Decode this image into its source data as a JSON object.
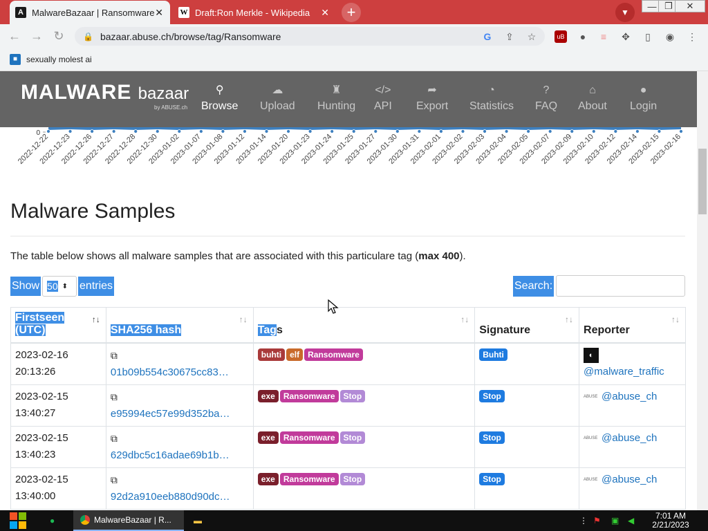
{
  "browser": {
    "tabs": [
      {
        "title": "MalwareBazaar | Ransomware",
        "favicon": "A"
      },
      {
        "title": "Draft:Ron Merkle - Wikipedia",
        "favicon": "W"
      }
    ],
    "url": "bazaar.abuse.ch/browse/tag/Ransomware",
    "bookmark": "sexually molest ai"
  },
  "site": {
    "logo_main": "MALWARE",
    "logo_light": "bazaar",
    "logo_sub": "by ABUSE.ch",
    "nav": [
      {
        "label": "Browse",
        "icon": "search-icon",
        "glyph": "🔍"
      },
      {
        "label": "Upload",
        "icon": "cloud-upload-icon",
        "glyph": "☁"
      },
      {
        "label": "Hunting",
        "icon": "hunting-icon",
        "glyph": "♜"
      },
      {
        "label": "API",
        "icon": "code-icon",
        "glyph": "</>"
      },
      {
        "label": "Export",
        "icon": "export-icon",
        "glyph": "➦"
      },
      {
        "label": "Statistics",
        "icon": "pie-chart-icon",
        "glyph": "◔"
      },
      {
        "label": "FAQ",
        "icon": "question-icon",
        "glyph": "?"
      },
      {
        "label": "About",
        "icon": "building-icon",
        "glyph": "⌂"
      },
      {
        "label": "Login",
        "icon": "user-icon",
        "glyph": "👤"
      }
    ]
  },
  "chart_data": {
    "type": "area",
    "y_tick_visible": "0",
    "categories": [
      "2022-12-22",
      "2022-12-23",
      "2022-12-26",
      "2022-12-27",
      "2022-12-28",
      "2022-12-30",
      "2023-01-02",
      "2023-01-07",
      "2023-01-08",
      "2023-01-12",
      "2023-01-14",
      "2023-01-20",
      "2023-01-23",
      "2023-01-24",
      "2023-01-25",
      "2023-01-27",
      "2023-01-30",
      "2023-01-31",
      "2023-02-01",
      "2023-02-02",
      "2023-02-03",
      "2023-02-04",
      "2023-02-05",
      "2023-02-07",
      "2023-02-09",
      "2023-02-10",
      "2023-02-12",
      "2023-02-14",
      "2023-02-15",
      "2023-02-16"
    ],
    "color": "#3c7fbf"
  },
  "content": {
    "title": "Malware Samples",
    "desc_prefix": "The table below shows all malware samples that are associated with this particulare tag (",
    "desc_bold": "max 400",
    "desc_suffix": ").",
    "show_label": "Show",
    "entries_value": "50",
    "entries_label": "entries",
    "search_label": "Search:"
  },
  "table": {
    "headers": {
      "firstseen": "Firstseen (UTC)",
      "firstseen_l1": "Firstseen",
      "firstseen_l2": "(UTC)",
      "sha256": "SHA256 hash",
      "tags_hl": "Tag",
      "tags_rest": "s",
      "signature": "Signature",
      "reporter": "Reporter"
    },
    "rows": [
      {
        "date": "2023-02-16",
        "time": "20:13:26",
        "hash": "01b09b554c30675cc83…",
        "tags": [
          {
            "t": "buhti",
            "c": "#a93a3a"
          },
          {
            "t": "elf",
            "c": "#c96a2a"
          },
          {
            "t": "Ransomware",
            "c": "#c13b9b"
          }
        ],
        "signature": "Buhti",
        "reporter": "@malware_traffic",
        "rep_type": "avatar"
      },
      {
        "date": "2023-02-15",
        "time": "13:40:27",
        "hash": "e95994ec57e99d352ba…",
        "tags": [
          {
            "t": "exe",
            "c": "#7a1f2b"
          },
          {
            "t": "Ransomware",
            "c": "#c13b9b"
          },
          {
            "t": "Stop",
            "c": "#b28ad6"
          }
        ],
        "signature": "Stop",
        "reporter": "@abuse_ch",
        "rep_type": "logo"
      },
      {
        "date": "2023-02-15",
        "time": "13:40:23",
        "hash": "629dbc5c16adae69b1b…",
        "tags": [
          {
            "t": "exe",
            "c": "#7a1f2b"
          },
          {
            "t": "Ransomware",
            "c": "#c13b9b"
          },
          {
            "t": "Stop",
            "c": "#b28ad6"
          }
        ],
        "signature": "Stop",
        "reporter": "@abuse_ch",
        "rep_type": "logo"
      },
      {
        "date": "2023-02-15",
        "time": "13:40:00",
        "hash": "92d2a910eeb880d90dc…",
        "tags": [
          {
            "t": "exe",
            "c": "#7a1f2b"
          },
          {
            "t": "Ransomware",
            "c": "#c13b9b"
          },
          {
            "t": "Stop",
            "c": "#b28ad6"
          }
        ],
        "signature": "Stop",
        "reporter": "@abuse_ch",
        "rep_type": "logo"
      }
    ],
    "signature_color": "#1e7be0"
  },
  "taskbar": {
    "app_label": "MalwareBazaar | R...",
    "time": "7:01 AM",
    "date": "2/21/2023"
  }
}
